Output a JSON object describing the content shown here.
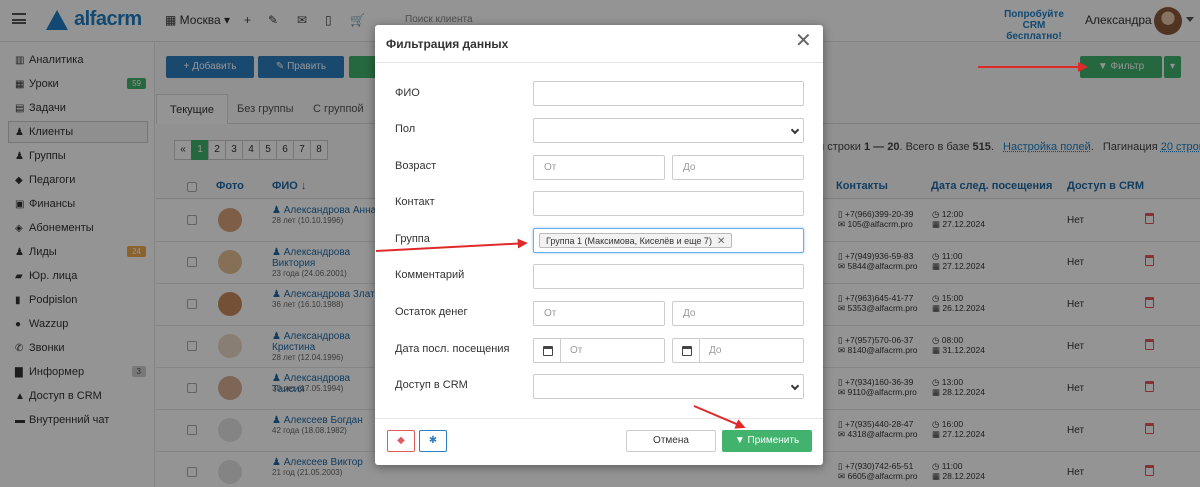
{
  "topbar": {
    "logo": "alfacrm",
    "branch": "Москва",
    "search_placeholder": "Поиск клиента",
    "promo": "Попробуйте CRM бесплатно!",
    "user": "Александра"
  },
  "sidebar": {
    "items": [
      {
        "icon": "chart-icon",
        "label": "Аналитика"
      },
      {
        "icon": "calendar-icon",
        "label": "Уроки",
        "badge": "59",
        "badge_color": "#41b36d"
      },
      {
        "icon": "list-icon",
        "label": "Задачи"
      },
      {
        "icon": "user-icon",
        "label": "Клиенты",
        "active": true
      },
      {
        "icon": "users-icon",
        "label": "Группы"
      },
      {
        "icon": "graduation-icon",
        "label": "Педагоги"
      },
      {
        "icon": "money-icon",
        "label": "Финансы"
      },
      {
        "icon": "tag-icon",
        "label": "Абонементы"
      },
      {
        "icon": "lead-icon",
        "label": "Лиды",
        "badge": "24",
        "badge_color": "#f0ad4e"
      },
      {
        "icon": "briefcase-icon",
        "label": "Юр. лица"
      },
      {
        "icon": "file-icon",
        "label": "Podpislon"
      },
      {
        "icon": "whatsapp-icon",
        "label": "Wazzup"
      },
      {
        "icon": "phone-icon",
        "label": "Звонки"
      },
      {
        "icon": "info-icon",
        "label": "Информер",
        "badge": "3",
        "badge_color": "#cfcfcf"
      },
      {
        "icon": "key-icon",
        "label": "Доступ в CRM"
      },
      {
        "icon": "chat-icon",
        "label": "Внутренний чат"
      }
    ]
  },
  "toolbar": {
    "add_label": "+ Добавить",
    "edit_label": "Править",
    "filter_label": "Фильтр"
  },
  "tabs": [
    "Текущие",
    "Без группы",
    "С группой"
  ],
  "pagination": {
    "pages": [
      "«",
      "1",
      "2",
      "3",
      "4",
      "5",
      "6",
      "7",
      "8"
    ],
    "active": "1",
    "info_prefix": "и строки",
    "info_range": "1 — 20",
    "info_middle": ". Всего в базе",
    "info_total": "515",
    "info_end": ".",
    "settings_link": "Настройка полей",
    "pagination_label": "Пагинация",
    "pagination_link": "20 строк"
  },
  "table": {
    "headers": {
      "photo": "Фото",
      "name": "ФИО ↓",
      "contacts": "Контакты",
      "next_visit": "Дата след. посещения",
      "access": "Доступ в CRM"
    },
    "rows": [
      {
        "name": "Александрова Анна",
        "age": "28 лет (10.10.1996)",
        "phone": "+7(966)399-20-39",
        "email": "105@alfacrm.pro",
        "time": "12:00",
        "date": "27.12.2024",
        "access": "Нет"
      },
      {
        "name": "Александрова Виктория",
        "age": "23 года (24.06.2001)",
        "phone": "+7(949)936-59-83",
        "email": "5844@alfacrm.pro",
        "time": "11:00",
        "date": "27.12.2024",
        "access": "Нет"
      },
      {
        "name": "Александрова Злата",
        "age": "36 лет (16.10.1988)",
        "phone": "+7(963)645-41-77",
        "email": "5353@alfacrm.pro",
        "time": "15:00",
        "date": "26.12.2024",
        "access": "Нет"
      },
      {
        "name": "Александрова Кристина",
        "age": "28 лет (12.04.1996)",
        "phone": "+7(957)570-06-37",
        "email": "8140@alfacrm.pro",
        "time": "08:00",
        "date": "31.12.2024",
        "access": "Нет"
      },
      {
        "name": "Александрова Таисия",
        "age": "30 лет (17.05.1994)",
        "phone": "+7(934)160-36-39",
        "email": "9110@alfacrm.pro",
        "time": "13:00",
        "date": "28.12.2024",
        "access": "Нет"
      },
      {
        "name": "Алексеев Богдан",
        "age": "42 года (18.08.1982)",
        "phone": "+7(935)440-28-47",
        "email": "4318@alfacrm.pro",
        "time": "16:00",
        "date": "27.12.2024",
        "access": "Нет"
      },
      {
        "name": "Алексеев Виктор",
        "age": "21 год (21.05.2003)",
        "phone": "+7(930)742-65-51",
        "email": "6605@alfacrm.pro",
        "time": "11:00",
        "date": "28.12.2024",
        "access": "Нет"
      }
    ]
  },
  "modal": {
    "title": "Фильтрация данных",
    "fields": {
      "fio": "ФИО",
      "gender": "Пол",
      "age": "Возраст",
      "contact": "Контакт",
      "group": "Группа",
      "comment": "Комментарий",
      "balance": "Остаток денег",
      "last_visit": "Дата посл. посещения",
      "crm_access": "Доступ в CRM"
    },
    "from_placeholder": "От",
    "to_placeholder": "До",
    "group_tag": "Группа 1 (Максимова, Киселёв и еще 7)",
    "cancel_label": "Отмена",
    "apply_label": "Применить"
  },
  "colors": {
    "primary": "#1e7fc4",
    "green": "#41b36d",
    "arrow": "#e02a2a"
  }
}
